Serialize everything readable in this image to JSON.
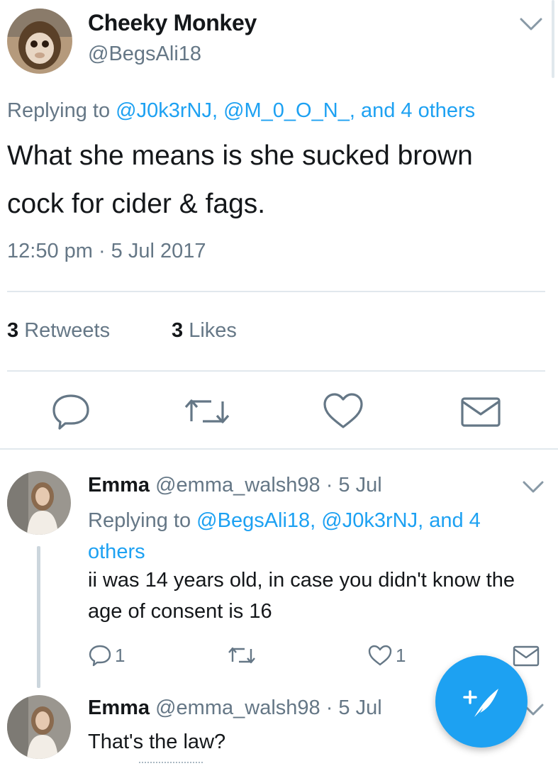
{
  "main_tweet": {
    "name": "Cheeky Monkey",
    "handle": "@BegsAli18",
    "replying_prefix": "Replying to ",
    "mention_1": "@J0k3rNJ,",
    "mention_2": "@M_0_O_N_,",
    "mention_3": "and 4 others",
    "text": "What she means is she sucked brown cock for cider & fags.",
    "timestamp": "12:50 pm · 5 Jul 2017",
    "retweets_count": "3",
    "retweets_label": "Retweets",
    "likes_count": "3",
    "likes_label": "Likes"
  },
  "replies": [
    {
      "name": "Emma",
      "handle": "@emma_walsh98",
      "date": "· 5 Jul",
      "replying_prefix": "Replying to ",
      "replying_mentions": "@BegsAli18, @J0k3rNJ, and 4 others",
      "text": "ii was 14 years old, in case you didn't know the age of consent is 16",
      "reply_count": "1",
      "like_count": "1"
    },
    {
      "name": "Emma",
      "handle": "@emma_walsh98",
      "date": "· 5 Jul",
      "text": "That's the law?"
    }
  ],
  "icons": {
    "caret": "chevron-down-icon",
    "reply": "comment-bubble-icon",
    "retweet": "retweet-icon",
    "like": "heart-icon",
    "dm": "envelope-icon",
    "compose": "compose-feather-icon"
  },
  "colors": {
    "accent": "#1da1f2",
    "text": "#14171a",
    "secondary": "#657786",
    "divider": "#e1e8ed"
  }
}
